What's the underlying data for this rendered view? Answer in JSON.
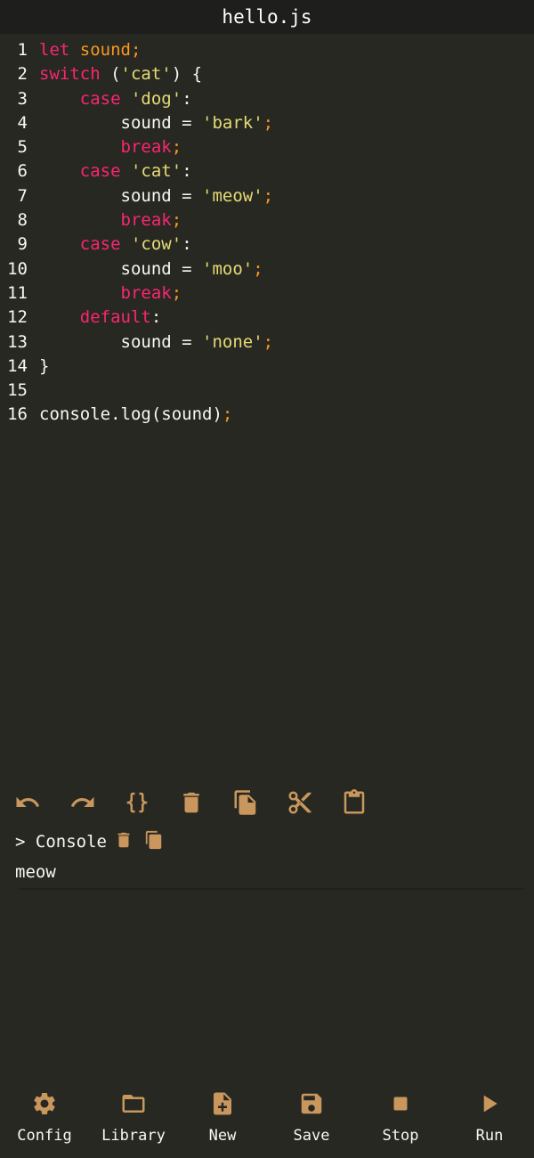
{
  "title": "hello.js",
  "accent_color": "#c9965d",
  "code_lines": [
    [
      {
        "t": "let ",
        "c": "kw"
      },
      {
        "t": "sound",
        "c": "var"
      },
      {
        "t": ";",
        "c": "punc"
      }
    ],
    [
      {
        "t": "switch",
        "c": "kw"
      },
      {
        "t": " (",
        "c": "plain"
      },
      {
        "t": "'cat'",
        "c": "str"
      },
      {
        "t": ") {",
        "c": "plain"
      }
    ],
    [
      {
        "t": "    ",
        "c": "plain"
      },
      {
        "t": "case",
        "c": "kw"
      },
      {
        "t": " ",
        "c": "plain"
      },
      {
        "t": "'dog'",
        "c": "str"
      },
      {
        "t": ":",
        "c": "plain"
      }
    ],
    [
      {
        "t": "        sound = ",
        "c": "plain"
      },
      {
        "t": "'bark'",
        "c": "str"
      },
      {
        "t": ";",
        "c": "punc"
      }
    ],
    [
      {
        "t": "        ",
        "c": "plain"
      },
      {
        "t": "break",
        "c": "kw"
      },
      {
        "t": ";",
        "c": "punc"
      }
    ],
    [
      {
        "t": "    ",
        "c": "plain"
      },
      {
        "t": "case",
        "c": "kw"
      },
      {
        "t": " ",
        "c": "plain"
      },
      {
        "t": "'cat'",
        "c": "str"
      },
      {
        "t": ":",
        "c": "plain"
      }
    ],
    [
      {
        "t": "        sound = ",
        "c": "plain"
      },
      {
        "t": "'meow'",
        "c": "str"
      },
      {
        "t": ";",
        "c": "punc"
      }
    ],
    [
      {
        "t": "        ",
        "c": "plain"
      },
      {
        "t": "break",
        "c": "kw"
      },
      {
        "t": ";",
        "c": "punc"
      }
    ],
    [
      {
        "t": "    ",
        "c": "plain"
      },
      {
        "t": "case",
        "c": "kw"
      },
      {
        "t": " ",
        "c": "plain"
      },
      {
        "t": "'cow'",
        "c": "str"
      },
      {
        "t": ":",
        "c": "plain"
      }
    ],
    [
      {
        "t": "        sound = ",
        "c": "plain"
      },
      {
        "t": "'moo'",
        "c": "str"
      },
      {
        "t": ";",
        "c": "punc"
      }
    ],
    [
      {
        "t": "        ",
        "c": "plain"
      },
      {
        "t": "break",
        "c": "kw"
      },
      {
        "t": ";",
        "c": "punc"
      }
    ],
    [
      {
        "t": "    ",
        "c": "plain"
      },
      {
        "t": "default",
        "c": "kw"
      },
      {
        "t": ":",
        "c": "plain"
      }
    ],
    [
      {
        "t": "        sound = ",
        "c": "plain"
      },
      {
        "t": "'none'",
        "c": "str"
      },
      {
        "t": ";",
        "c": "punc"
      }
    ],
    [
      {
        "t": "}",
        "c": "plain"
      }
    ],
    [],
    [
      {
        "t": "console.log(sound)",
        "c": "plain"
      },
      {
        "t": ";",
        "c": "punc"
      }
    ]
  ],
  "toolbar": {
    "icons": [
      "undo-icon",
      "redo-icon",
      "format-braces-icon",
      "delete-icon",
      "copy-icon",
      "cut-icon",
      "paste-icon"
    ]
  },
  "console": {
    "label": "> Console",
    "output": "meow"
  },
  "nav": {
    "config": "Config",
    "library": "Library",
    "new": "New",
    "save": "Save",
    "stop": "Stop",
    "run": "Run"
  }
}
